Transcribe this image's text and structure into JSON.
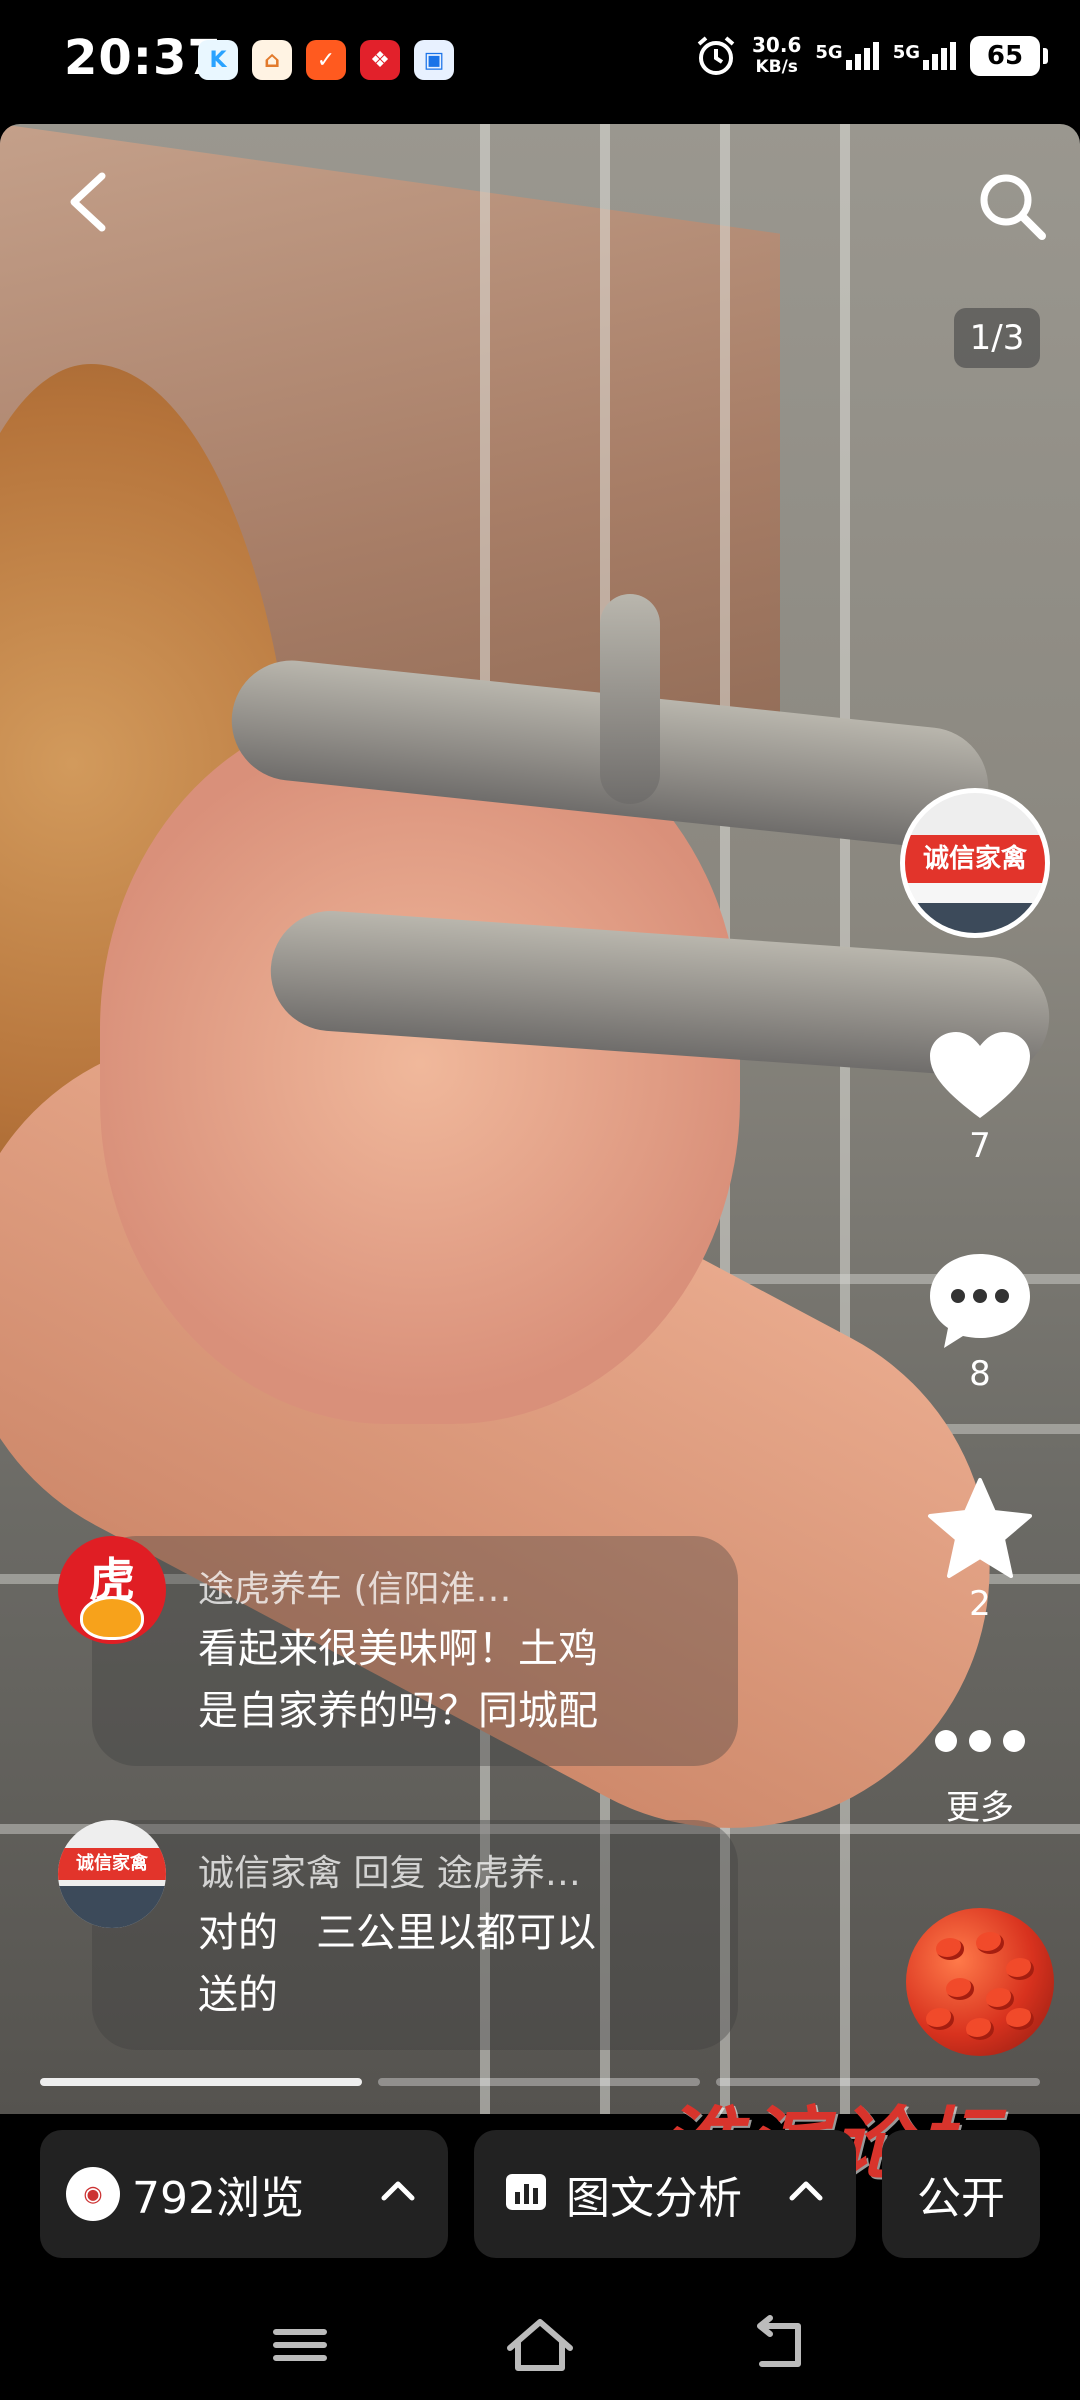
{
  "status_bar": {
    "time": "20:37",
    "net_speed_value": "30.6",
    "net_speed_unit": "KB/s",
    "sim1_label": "5G",
    "sim2_label": "5G",
    "battery": "65",
    "app_icons": [
      "kuaishou-k-icon",
      "app-house-icon",
      "app-orange-icon",
      "app-red-icon",
      "app-chat-icon"
    ],
    "alarm_icon": "alarm-clock-icon"
  },
  "viewer": {
    "page_indicator": "1/3",
    "back_icon": "back-arrow-icon",
    "search_icon": "search-icon"
  },
  "author": {
    "avatar_banner": "诚信家禽"
  },
  "actions": {
    "like_count": "7",
    "comment_count": "8",
    "favorite_count": "2",
    "more_label": "更多"
  },
  "comments": [
    {
      "avatar_char": "虎",
      "name": "途虎养车 (信阳淮…",
      "text_line1": "看起来很美味啊！土鸡",
      "text_line2": "是自家养的吗？同城配"
    },
    {
      "avatar_banner": "诚信家禽",
      "name": "诚信家禽 回复 途虎养…",
      "text_line1": "对的   三公里以都可以",
      "text_line2": "送的"
    }
  ],
  "progress": {
    "total_segments": 3,
    "active_segment": 1
  },
  "watermark": "淮滨论坛",
  "bottom_bar": {
    "views_label": "792浏览",
    "analysis_label": "图文分析",
    "public_label": "公开"
  },
  "colors": {
    "accent_red": "#e2342b",
    "panel_bg": "#222222"
  }
}
